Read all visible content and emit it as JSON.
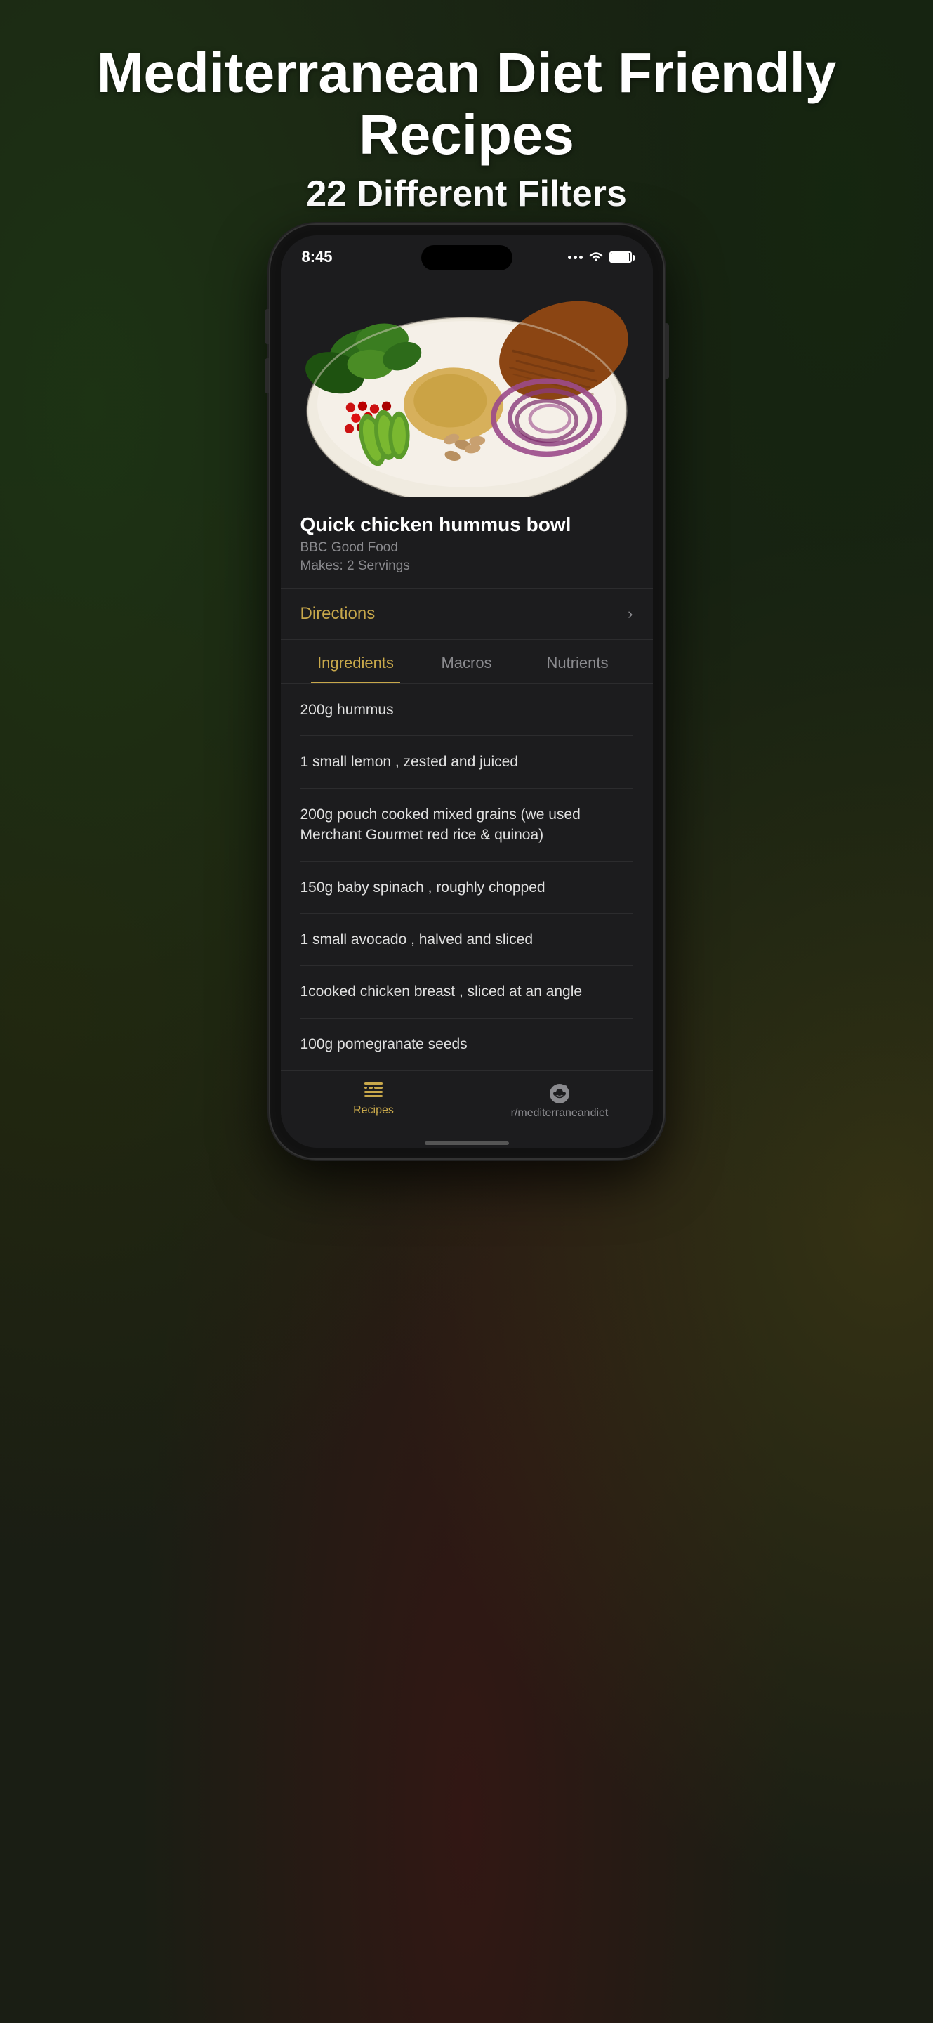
{
  "background": {
    "color": "#1a1e14"
  },
  "hero": {
    "title": "Mediterranean Diet Friendly Recipes",
    "subtitle": "22 Different Filters"
  },
  "phone": {
    "status_bar": {
      "time": "8:45",
      "signal_dots": 3,
      "wifi": true,
      "battery": true
    },
    "recipe": {
      "image_alt": "Quick chicken hummus bowl",
      "title": "Quick chicken hummus bowl",
      "source": "BBC Good Food",
      "servings": "Makes: 2 Servings"
    },
    "directions": {
      "label": "Directions",
      "arrow": "›"
    },
    "tabs": [
      {
        "id": "ingredients",
        "label": "Ingredients",
        "active": true
      },
      {
        "id": "macros",
        "label": "Macros",
        "active": false
      },
      {
        "id": "nutrients",
        "label": "Nutrients",
        "active": false
      }
    ],
    "ingredients": [
      {
        "id": 1,
        "text": "200g hummus"
      },
      {
        "id": 2,
        "text": "1 small lemon , zested and juiced"
      },
      {
        "id": 3,
        "text": "200g pouch cooked mixed grains (we used Merchant Gourmet red rice & quinoa)"
      },
      {
        "id": 4,
        "text": "150g baby spinach , roughly chopped"
      },
      {
        "id": 5,
        "text": "1 small avocado , halved and sliced"
      },
      {
        "id": 6,
        "text": "1cooked chicken breast , sliced at an angle"
      },
      {
        "id": 7,
        "text": "100g pomegranate seeds"
      }
    ],
    "bottom_nav": [
      {
        "id": "recipes",
        "label": "Recipes",
        "active": true,
        "icon": "list-icon"
      },
      {
        "id": "reddit",
        "label": "r/mediterraneandiet",
        "active": false,
        "icon": "reddit-icon"
      }
    ]
  }
}
